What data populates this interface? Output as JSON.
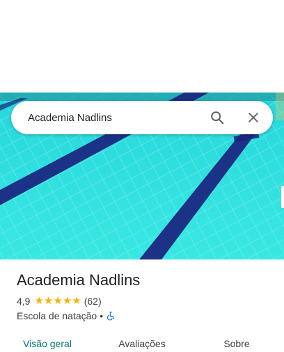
{
  "search": {
    "query": "Academia Nadlins",
    "search_icon": "search-icon",
    "close_icon": "close-icon"
  },
  "place": {
    "name": "Academia Nadlins",
    "rating": "4,9",
    "stars": 5,
    "review_count": "(62)",
    "category": "Escola de natação",
    "separator": "•",
    "accessibility_icon": "wheelchair-icon"
  },
  "tabs": [
    {
      "label": "Visão geral",
      "active": true
    },
    {
      "label": "Avaliações",
      "active": false
    },
    {
      "label": "Sobre",
      "active": false
    }
  ],
  "colors": {
    "accent": "#00796b",
    "star": "#f4b400",
    "accessibility": "#1a73e8",
    "pool_water": "#2ee0e0",
    "lane_line": "#1a237e"
  }
}
